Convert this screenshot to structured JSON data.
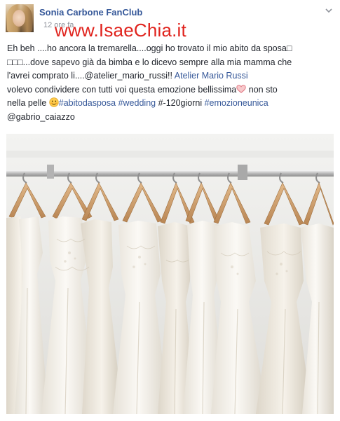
{
  "header": {
    "page_name": "Sonia Carbone FanClub",
    "timestamp": "12 ore fa",
    "watermark": "www.IsaeChia.it"
  },
  "post": {
    "line1": "Eh beh ....ho ancora la tremarella....oggi ho trovato il mio abito da sposa",
    "line1_glyph": "□",
    "line2_glyphs": "□□□",
    "line2": "...dove sapevo già da bimba e lo dicevo sempre alla mia mamma che",
    "line3_text": "l'avrei comprato li....@atelier_mario_russi!!",
    "line3_link": "Atelier Mario Russi",
    "line4_text": "volevo condividere con tutti voi questa emozione bellissima",
    "line4_after": " non sto",
    "line5_start": "nella pelle ",
    "hashtag_abitodasposa": "#abitodasposa",
    "hashtag_wedding": "#wedding",
    "countdown": "#-120giorni",
    "hashtag_emozioneunica": "#emozioneunica",
    "mention": "@gabrio_caiazzo"
  },
  "photo": {
    "subject": "wedding dresses on wooden hangers"
  },
  "colors": {
    "link": "#365899",
    "watermark": "#e0231d",
    "muted": "#90949c"
  }
}
